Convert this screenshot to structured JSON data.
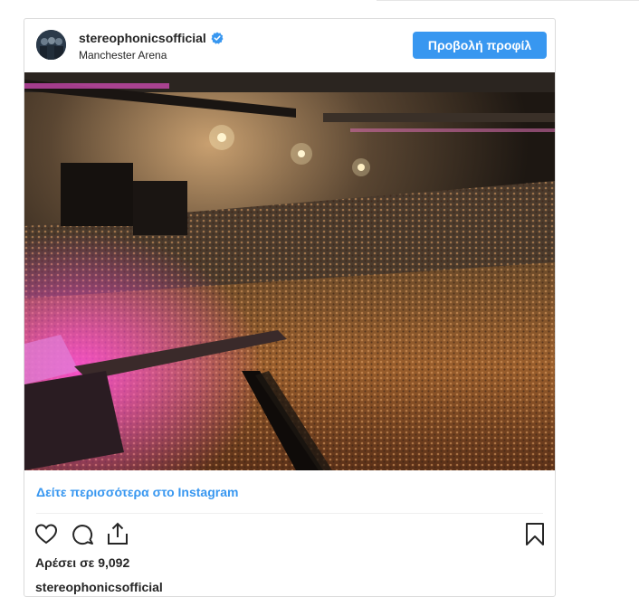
{
  "post": {
    "username": "stereophonicsofficial",
    "location": "Manchester Arena",
    "view_profile_label": "Προβολή προφίλ",
    "see_more_label": "Δείτε περισσότερα στο Instagram",
    "likes_text": "Αρέσει σε 9,092",
    "caption_username": "stereophonicsofficial"
  },
  "icons": {
    "verified": "verified-badge-icon",
    "like": "heart-icon",
    "comment": "comment-bubble-icon",
    "share": "share-upload-icon",
    "save": "bookmark-icon"
  },
  "colors": {
    "accent": "#3897f0",
    "text": "#262626",
    "border": "#dbdbdb"
  }
}
